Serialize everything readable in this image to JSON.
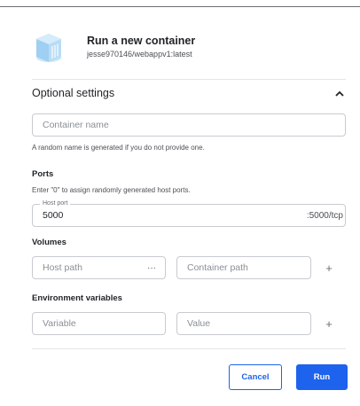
{
  "header": {
    "title": "Run a new container",
    "image": "jesse970146/webappv1:latest",
    "icon": "container-icon"
  },
  "optional_settings": {
    "title": "Optional settings",
    "expanded": true,
    "container_name": {
      "placeholder": "Container name",
      "value": ""
    },
    "container_name_hint": "A random name is generated if you do not provide one."
  },
  "ports": {
    "label": "Ports",
    "hint": "Enter \"0\" to assign randomly generated host ports.",
    "host_port_legend": "Host port",
    "host_port_value": "5000",
    "container_port": ":5000/tcp"
  },
  "volumes": {
    "label": "Volumes",
    "host_path_placeholder": "Host path",
    "browse_label": "···",
    "container_path_placeholder": "Container path",
    "add_label": "+"
  },
  "env": {
    "label": "Environment variables",
    "variable_placeholder": "Variable",
    "value_placeholder": "Value",
    "add_label": "+"
  },
  "actions": {
    "cancel": "Cancel",
    "run": "Run"
  },
  "colors": {
    "accent": "#1d63ed",
    "icon": "#9fcff2"
  }
}
